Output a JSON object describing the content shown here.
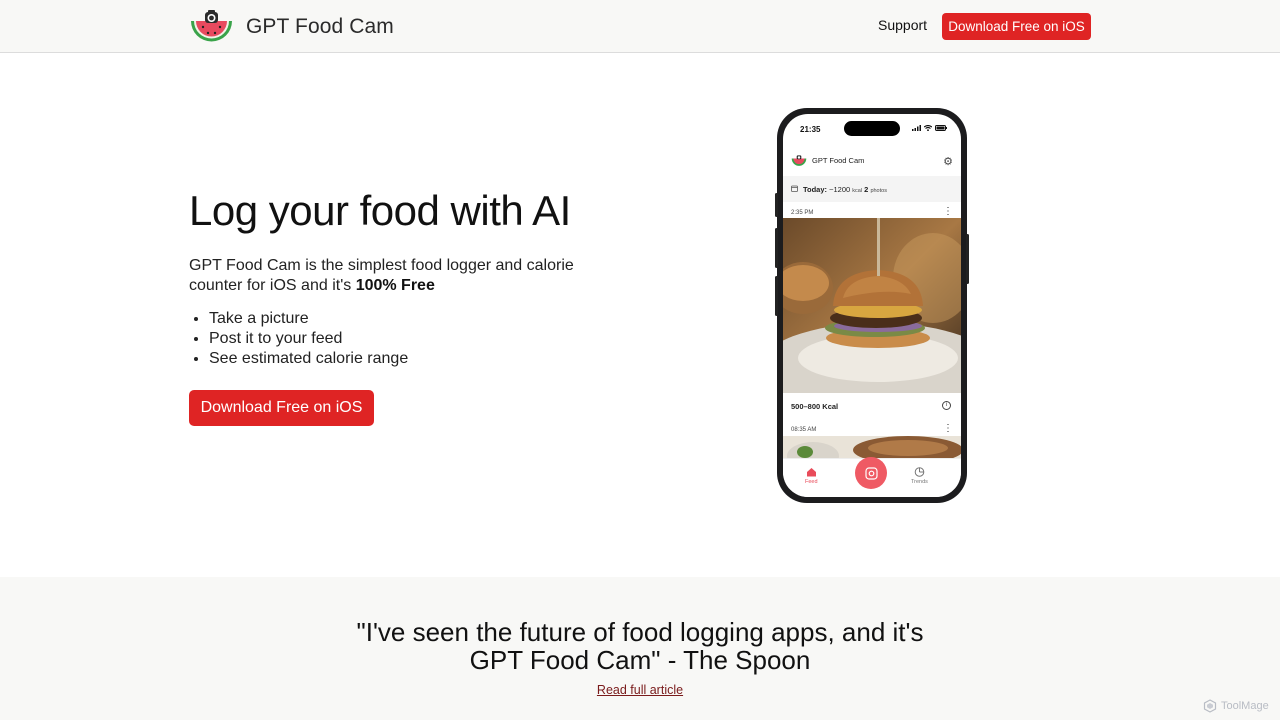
{
  "header": {
    "brand_name": "GPT Food Cam",
    "support_label": "Support",
    "download_label": "Download Free on iOS"
  },
  "hero": {
    "title": "Log your food with AI",
    "description_prefix": "GPT Food Cam is the simplest food logger and calorie counter for iOS and it's ",
    "description_bold": "100% Free",
    "bullets": [
      "Take a picture",
      "Post it to your feed",
      "See estimated calorie range"
    ],
    "download_label": "Download Free on iOS"
  },
  "phone": {
    "status_time": "21:35",
    "app_name": "GPT Food Cam",
    "today_label": "Today:",
    "today_kcal_value": "~1200",
    "today_kcal_unit": "kcal",
    "today_photos_count": "2",
    "today_photos_unit": "photos",
    "post1_time": "2:35 PM",
    "post1_kcal": "500–800 Kcal",
    "post2_time": "08:35 AM",
    "tabs": {
      "feed": "Feed",
      "trends": "Trends"
    }
  },
  "testimonial": {
    "quote_line1": "\"I've seen the future of food logging apps, and it's",
    "quote_line2": "GPT Food Cam\" - The Spoon",
    "link_label": "Read full article"
  },
  "watermark": {
    "label": "ToolMage"
  },
  "colors": {
    "accent_red": "#df2424",
    "app_pink": "#ef5a64",
    "link_maroon": "#7a1b1b"
  }
}
